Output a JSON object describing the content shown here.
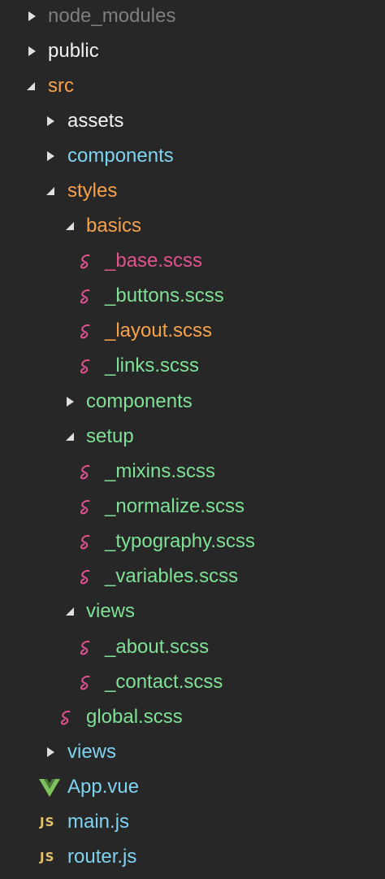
{
  "colors": {
    "background": "#272727",
    "muted": "#7c7f83",
    "white": "#f2f2f2",
    "orange": "#f6a24d",
    "blue": "#7fd3f0",
    "green": "#7fe096",
    "sass_icon": "#e2528f",
    "vue_icon": "#7ec35b",
    "js_icon": "#e2c36b"
  },
  "explorer": {
    "items": [
      {
        "label": "node_modules",
        "type": "folder",
        "expanded": false,
        "depth": 0
      },
      {
        "label": "public",
        "type": "folder",
        "expanded": false,
        "depth": 0
      },
      {
        "label": "src",
        "type": "folder",
        "expanded": true,
        "depth": 0
      },
      {
        "label": "assets",
        "type": "folder",
        "expanded": false,
        "depth": 1
      },
      {
        "label": "components",
        "type": "folder",
        "expanded": false,
        "depth": 1
      },
      {
        "label": "styles",
        "type": "folder",
        "expanded": true,
        "depth": 1
      },
      {
        "label": "basics",
        "type": "folder",
        "expanded": true,
        "depth": 2
      },
      {
        "label": "_base.scss",
        "type": "scss",
        "depth": 3
      },
      {
        "label": "_buttons.scss",
        "type": "scss",
        "depth": 3
      },
      {
        "label": "_layout.scss",
        "type": "scss",
        "depth": 3
      },
      {
        "label": "_links.scss",
        "type": "scss",
        "depth": 3
      },
      {
        "label": "components",
        "type": "folder",
        "expanded": false,
        "depth": 2
      },
      {
        "label": "setup",
        "type": "folder",
        "expanded": true,
        "depth": 2
      },
      {
        "label": "_mixins.scss",
        "type": "scss",
        "depth": 3
      },
      {
        "label": "_normalize.scss",
        "type": "scss",
        "depth": 3
      },
      {
        "label": "_typography.scss",
        "type": "scss",
        "depth": 3
      },
      {
        "label": "_variables.scss",
        "type": "scss",
        "depth": 3
      },
      {
        "label": "views",
        "type": "folder",
        "expanded": true,
        "depth": 2
      },
      {
        "label": "_about.scss",
        "type": "scss",
        "depth": 3
      },
      {
        "label": "_contact.scss",
        "type": "scss",
        "depth": 3
      },
      {
        "label": "global.scss",
        "type": "scss",
        "depth": 2
      },
      {
        "label": "views",
        "type": "folder",
        "expanded": false,
        "depth": 1
      },
      {
        "label": "App.vue",
        "type": "vue",
        "depth": 1
      },
      {
        "label": "main.js",
        "type": "js",
        "depth": 1
      },
      {
        "label": "router.js",
        "type": "js",
        "depth": 1
      }
    ],
    "js_badge": "JS"
  }
}
